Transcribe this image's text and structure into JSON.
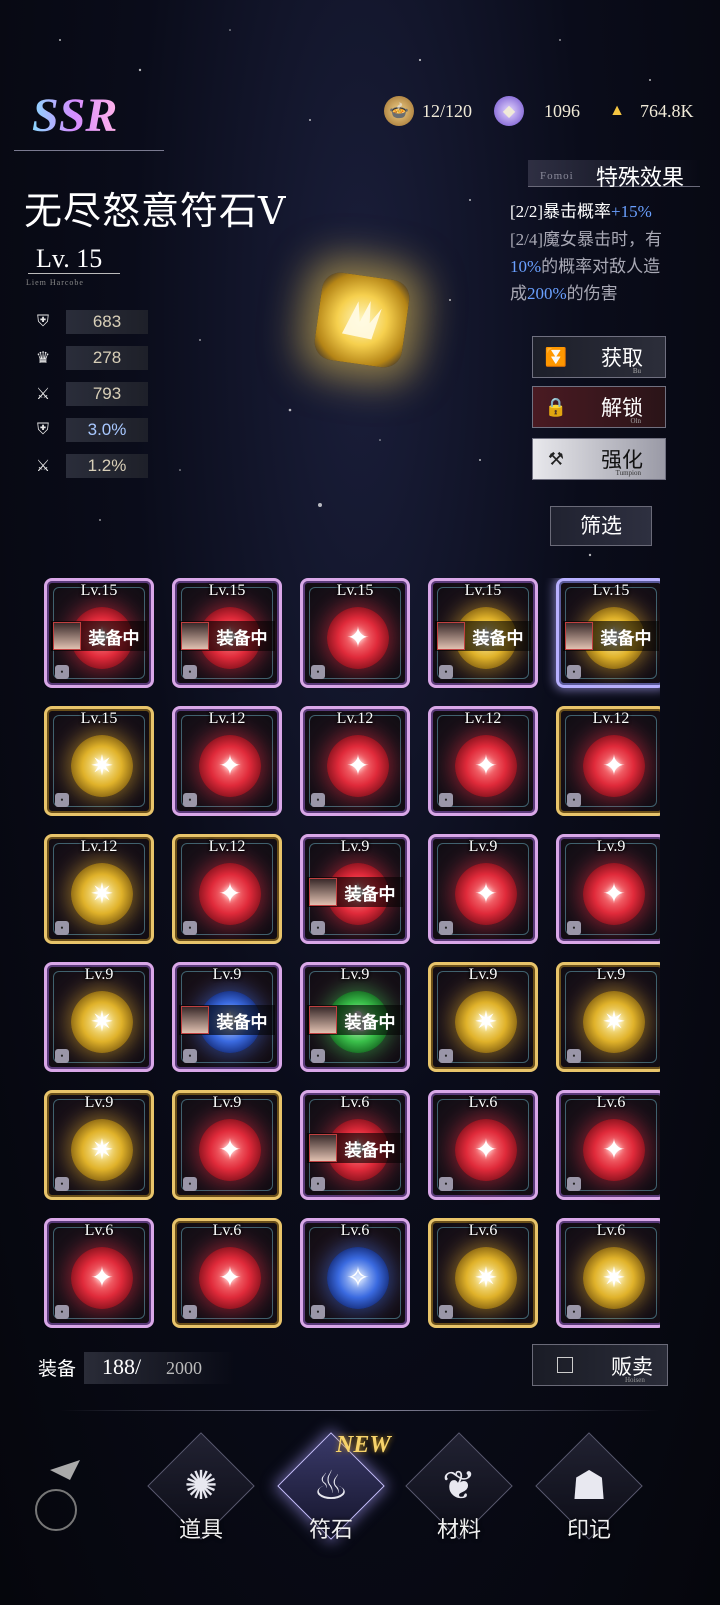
{
  "resources": {
    "stamina": {
      "value": "12/120",
      "icon": "food-icon"
    },
    "crystal": {
      "value": "1096",
      "icon": "crystal-icon"
    },
    "gold": {
      "value": "764.8K",
      "icon": "gold-ingot-icon"
    }
  },
  "item": {
    "rarity": "SSR",
    "name": "无尽怒意符石Ⅴ",
    "level": "Lv. 15",
    "level_sub": "Liem Harcobe",
    "stats": [
      {
        "icon": "defense-icon",
        "value": "683"
      },
      {
        "icon": "crown-icon",
        "value": "278"
      },
      {
        "icon": "attack-icon",
        "value": "793"
      },
      {
        "icon": "defense-icon",
        "value": "3.0%"
      },
      {
        "icon": "attack-icon",
        "value": "1.2%"
      }
    ]
  },
  "special": {
    "sub": "Fomoi",
    "title": "特殊效果",
    "effect1_prefix": "[2/2]暴击概率",
    "effect1_value": "+15%",
    "effect2_line1": "[2/4]魔女暴击时，有",
    "effect2_pct1": "10%",
    "effect2_mid": "的概率对敌人造",
    "effect2_pre": "成",
    "effect2_pct2": "200%",
    "effect2_post": "的伤害"
  },
  "actions": {
    "obtain": "获取",
    "obtain_sub": "Bu",
    "unlock": "解锁",
    "unlock_sub": "Oln",
    "enhance": "强化",
    "enhance_sub": "Tumpion",
    "filter": "筛选"
  },
  "equipped_label": "装备中",
  "runes": [
    {
      "level": "Lv.15",
      "color": "red",
      "frame": "purple",
      "equipped": true
    },
    {
      "level": "Lv.15",
      "color": "red",
      "frame": "purple",
      "equipped": true
    },
    {
      "level": "Lv.15",
      "color": "red",
      "frame": "purple",
      "equipped": false
    },
    {
      "level": "Lv.15",
      "color": "yellow",
      "frame": "purple",
      "equipped": true
    },
    {
      "level": "Lv.15",
      "color": "yellow",
      "frame": "sel",
      "equipped": true
    },
    {
      "level": "Lv.15",
      "color": "yellow",
      "frame": "gold",
      "equipped": false
    },
    {
      "level": "Lv.12",
      "color": "red",
      "frame": "purple",
      "equipped": false
    },
    {
      "level": "Lv.12",
      "color": "red",
      "frame": "purple",
      "equipped": false
    },
    {
      "level": "Lv.12",
      "color": "red",
      "frame": "purple",
      "equipped": false
    },
    {
      "level": "Lv.12",
      "color": "red",
      "frame": "gold",
      "equipped": false
    },
    {
      "level": "Lv.12",
      "color": "yellow",
      "frame": "gold",
      "equipped": false
    },
    {
      "level": "Lv.12",
      "color": "red",
      "frame": "gold",
      "equipped": false
    },
    {
      "level": "Lv.9",
      "color": "red",
      "frame": "purple",
      "equipped": true
    },
    {
      "level": "Lv.9",
      "color": "red",
      "frame": "purple",
      "equipped": false
    },
    {
      "level": "Lv.9",
      "color": "red",
      "frame": "purple",
      "equipped": false
    },
    {
      "level": "Lv.9",
      "color": "yellow",
      "frame": "purple",
      "equipped": false
    },
    {
      "level": "Lv.9",
      "color": "blue",
      "frame": "purple",
      "equipped": true
    },
    {
      "level": "Lv.9",
      "color": "green",
      "frame": "purple",
      "equipped": true
    },
    {
      "level": "Lv.9",
      "color": "yellow",
      "frame": "gold",
      "equipped": false
    },
    {
      "level": "Lv.9",
      "color": "yellow",
      "frame": "gold",
      "equipped": false
    },
    {
      "level": "Lv.9",
      "color": "yellow",
      "frame": "gold",
      "equipped": false
    },
    {
      "level": "Lv.9",
      "color": "red",
      "frame": "gold",
      "equipped": false
    },
    {
      "level": "Lv.6",
      "color": "red",
      "frame": "purple",
      "equipped": true
    },
    {
      "level": "Lv.6",
      "color": "red",
      "frame": "purple",
      "equipped": false
    },
    {
      "level": "Lv.6",
      "color": "red",
      "frame": "purple",
      "equipped": false
    },
    {
      "level": "Lv.6",
      "color": "red",
      "frame": "purple",
      "equipped": false
    },
    {
      "level": "Lv.6",
      "color": "red",
      "frame": "gold",
      "equipped": false
    },
    {
      "level": "Lv.6",
      "color": "blue",
      "frame": "purple",
      "equipped": false
    },
    {
      "level": "Lv.6",
      "color": "yellow",
      "frame": "gold",
      "equipped": false
    },
    {
      "level": "Lv.6",
      "color": "yellow",
      "frame": "purple",
      "equipped": false
    }
  ],
  "capacity": {
    "label": "装备",
    "current": "188/",
    "max": "2000"
  },
  "sell": {
    "label": "贩卖",
    "sub": "Hoisen"
  },
  "nav": {
    "items": "道具",
    "runes": "符石",
    "materials": "材料",
    "seal": "印记",
    "new_tag": "NEW"
  },
  "colors": {
    "accent_blue": "#6aa0ff",
    "gold": "#e8c46a",
    "purple": "#d9a7e8"
  }
}
